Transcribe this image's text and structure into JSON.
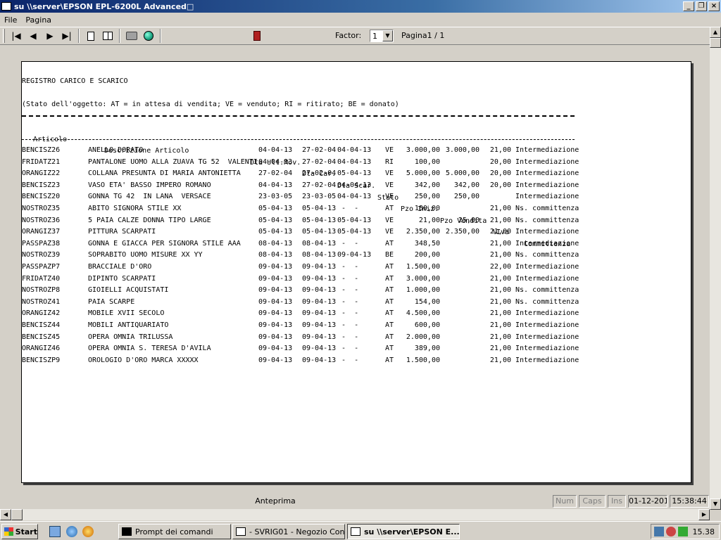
{
  "window": {
    "title": "su \\\\server\\EPSON EPL-6200L Advanced□"
  },
  "menu": {
    "items": [
      "File",
      "Pagina"
    ]
  },
  "toolbar": {
    "factor_label": "Factor:",
    "factor_value": "1",
    "page_indicator": "Pagina1 / 1"
  },
  "report": {
    "title": "REGISTRO CARICO E SCARICO",
    "legend": "(Stato dell'oggetto: AT = in attesa di vendita; VE = venduto; RI = ritirato; BE = donato)",
    "columns": {
      "articolo": "Articolo",
      "descrizione": "Descrizione Articolo",
      "dta_ult_mov": "Dta Ult.Mov.",
      "dta_car": "Dta Car.",
      "dta_scar": "Dta Scar.",
      "stato": "Stato",
      "pzo_iniz": "Pzo Iniz.",
      "pzo_vendita": "Pzo Vendita",
      "iva": "%Iva",
      "committenza": "Committenza"
    },
    "rows": [
      {
        "art": "BENCISZ26",
        "desc": "ANELLO DORATO",
        "dtu": "04-04-13",
        "dtc": "27-02-04",
        "dts": "04-04-13",
        "stato": "VE",
        "pzi": "3.000,00",
        "pzv": "3.000,00",
        "iva": "21,00",
        "comm": "Intermediazione"
      },
      {
        "art": "FRIDATZ21",
        "desc": "PANTALONE UOMO ALLA ZUAVA TG 52  VALENTI",
        "dtu": "04-04-13",
        "dtc": "27-02-04",
        "dts": "04-04-13",
        "stato": "RI",
        "pzi": "100,00",
        "pzv": "",
        "iva": "20,00",
        "comm": "Intermediazione"
      },
      {
        "art": "ORANGIZ22",
        "desc": "COLLANA PRESUNTA DI MARIA ANTONIETTA",
        "dtu": "27-02-04",
        "dtc": "27-02-04",
        "dts": "05-04-13",
        "stato": "VE",
        "pzi": "5.000,00",
        "pzv": "5.000,00",
        "iva": "20,00",
        "comm": "Intermediazione"
      },
      {
        "art": "BENCISZ23",
        "desc": "VASO ETA' BASSO IMPERO ROMANO",
        "dtu": "04-04-13",
        "dtc": "27-02-04",
        "dts": "04-04-13",
        "stato": "VE",
        "pzi": "342,00",
        "pzv": "342,00",
        "iva": "20,00",
        "comm": "Intermediazione"
      },
      {
        "art": "BENCISZ20",
        "desc": "GONNA TG 42  IN LANA  VERSACE",
        "dtu": "23-03-05",
        "dtc": "23-03-05",
        "dts": "04-04-13",
        "stato": "VE",
        "pzi": "250,00",
        "pzv": "250,00",
        "iva": "",
        "comm": "Intermediazione"
      },
      {
        "art": "NOSTROZ35",
        "desc": "ABITO SIGNORA STILE XX",
        "dtu": "05-04-13",
        "dtc": "05-04-13",
        "dts": " -  -",
        "stato": "AT",
        "pzi": "180,00",
        "pzv": "",
        "iva": "21,00",
        "comm": "Ns. committenza"
      },
      {
        "art": "NOSTROZ36",
        "desc": "5 PAIA CALZE DONNA TIPO LARGE",
        "dtu": "05-04-13",
        "dtc": "05-04-13",
        "dts": "05-04-13",
        "stato": "VE",
        "pzi": "21,00",
        "pzv": "25,00",
        "iva": "21,00",
        "comm": "Ns. committenza"
      },
      {
        "art": "ORANGIZ37",
        "desc": "PITTURA SCARPATI",
        "dtu": "05-04-13",
        "dtc": "05-04-13",
        "dts": "05-04-13",
        "stato": "VE",
        "pzi": "2.350,00",
        "pzv": "2.350,00",
        "iva": "21,00",
        "comm": "Intermediazione"
      },
      {
        "art": "PASSPAZ38",
        "desc": "GONNA E GIACCA PER SIGNORA STILE AAA",
        "dtu": "08-04-13",
        "dtc": "08-04-13",
        "dts": " -  -",
        "stato": "AT",
        "pzi": "348,50",
        "pzv": "",
        "iva": "21,00",
        "comm": "Intermediazione"
      },
      {
        "art": "NOSTROZ39",
        "desc": "SOPRABITO UOMO MISURE XX YY",
        "dtu": "08-04-13",
        "dtc": "08-04-13",
        "dts": "09-04-13",
        "stato": "BE",
        "pzi": "200,00",
        "pzv": "",
        "iva": "21,00",
        "comm": "Ns. committenza"
      },
      {
        "art": "PASSPAZP7",
        "desc": "BRACCIALE D'ORO",
        "dtu": "09-04-13",
        "dtc": "09-04-13",
        "dts": " -  -",
        "stato": "AT",
        "pzi": "1.500,00",
        "pzv": "",
        "iva": "22,00",
        "comm": "Intermediazione"
      },
      {
        "art": "FRIDATZ40",
        "desc": "DIPINTO SCARPATI",
        "dtu": "09-04-13",
        "dtc": "09-04-13",
        "dts": " -  -",
        "stato": "AT",
        "pzi": "3.000,00",
        "pzv": "",
        "iva": "21,00",
        "comm": "Intermediazione"
      },
      {
        "art": "NOSTROZP8",
        "desc": "GIOIELLI ACQUISTATI",
        "dtu": "09-04-13",
        "dtc": "09-04-13",
        "dts": " -  -",
        "stato": "AT",
        "pzi": "1.000,00",
        "pzv": "",
        "iva": "21,00",
        "comm": "Ns. committenza"
      },
      {
        "art": "NOSTROZ41",
        "desc": "PAIA SCARPE",
        "dtu": "09-04-13",
        "dtc": "09-04-13",
        "dts": " -  -",
        "stato": "AT",
        "pzi": "154,00",
        "pzv": "",
        "iva": "21,00",
        "comm": "Ns. committenza"
      },
      {
        "art": "ORANGIZ42",
        "desc": "MOBILE XVII SECOLO",
        "dtu": "09-04-13",
        "dtc": "09-04-13",
        "dts": " -  -",
        "stato": "AT",
        "pzi": "4.500,00",
        "pzv": "",
        "iva": "21,00",
        "comm": "Intermediazione"
      },
      {
        "art": "BENCISZ44",
        "desc": "MOBILI ANTIQUARIATO",
        "dtu": "09-04-13",
        "dtc": "09-04-13",
        "dts": " -  -",
        "stato": "AT",
        "pzi": "600,00",
        "pzv": "",
        "iva": "21,00",
        "comm": "Intermediazione"
      },
      {
        "art": "BENCISZ45",
        "desc": "OPERA OMNIA TRILUSSA",
        "dtu": "09-04-13",
        "dtc": "09-04-13",
        "dts": " -  -",
        "stato": "AT",
        "pzi": "2.000,00",
        "pzv": "",
        "iva": "21,00",
        "comm": "Intermediazione"
      },
      {
        "art": "ORANGIZ46",
        "desc": "OPERA OMNIA S. TERESA D'AVILA",
        "dtu": "09-04-13",
        "dtc": "09-04-13",
        "dts": " -  -",
        "stato": "AT",
        "pzi": "389,00",
        "pzv": "",
        "iva": "21,00",
        "comm": "Intermediazione"
      },
      {
        "art": "BENCISZP9",
        "desc": "OROLOGIO D'ORO MARCA XXXXX",
        "dtu": "09-04-13",
        "dtc": "09-04-13",
        "dts": " -  -",
        "stato": "AT",
        "pzi": "1.500,00",
        "pzv": "",
        "iva": "21,00",
        "comm": "Intermediazione"
      }
    ]
  },
  "statusbar": {
    "main": "Anteprima",
    "num": "Num",
    "caps": "Caps",
    "ins": "Ins",
    "date": "01-12-2015",
    "time": "15:38:44"
  },
  "taskbar": {
    "start": "Start",
    "tasks": [
      {
        "label": "Prompt dei comandi"
      },
      {
        "label": "- SVRIG01 - Negozio Con..."
      },
      {
        "label": "su \\\\server\\EPSON E..."
      }
    ],
    "clock": "15.38"
  },
  "icons": {
    "first": "first-page-icon",
    "prev": "prev-page-icon",
    "next": "next-page-icon",
    "last": "last-page-icon",
    "single": "single-page-icon",
    "double": "two-pages-icon",
    "print": "printer-icon",
    "export": "globe-icon",
    "exit": "exit-door-icon"
  }
}
